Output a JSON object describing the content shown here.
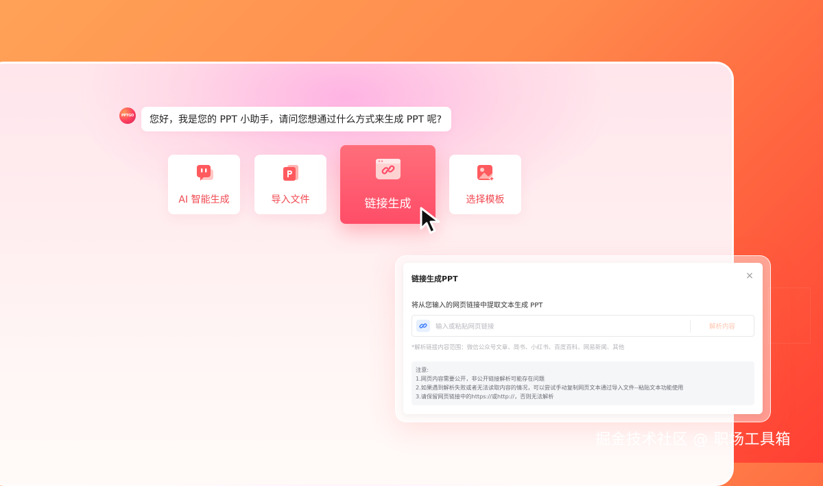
{
  "assistant": {
    "avatar_text": "PPTGO",
    "greeting": "您好，我是您的 PPT 小助手，请问您想通过什么方式来生成 PPT 呢?"
  },
  "options": [
    {
      "label": "AI 智能生成",
      "icon": "chat-icon",
      "active": false
    },
    {
      "label": "导入文件",
      "icon": "ppt-file-icon",
      "active": false
    },
    {
      "label": "链接生成",
      "icon": "link-window-icon",
      "active": true
    },
    {
      "label": "选择模板",
      "icon": "image-template-icon",
      "active": false
    }
  ],
  "dialog": {
    "title": "链接生成PPT",
    "close_icon": "close-icon",
    "description": "将从您输入的网页链接中提取文本生成 PPT",
    "input_placeholder": "输入或粘贴网页链接",
    "input_value": "",
    "parse_button": "解析内容",
    "scope_text": "*解析链接内容范围：微信公众号文章、简书、小红书、百度百科、网易新闻、其他",
    "notes": {
      "heading": "注意:",
      "lines": [
        "1.网页内容需要公开，非公开链接解析可能存在问题",
        "2.如果遇到解析失败或者无法读取内容的情况，可以尝试手动复制网页文本通过导入文件--粘贴文本功能使用",
        "3.请保留网页链接中的https://或http://，否则无法解析"
      ]
    }
  },
  "watermark": "掘金技术社区 @ 职场工具箱",
  "colors": {
    "accent": "#f04a52",
    "active_card": "#ff5a6e",
    "background_orange": "#ff8a4c"
  }
}
